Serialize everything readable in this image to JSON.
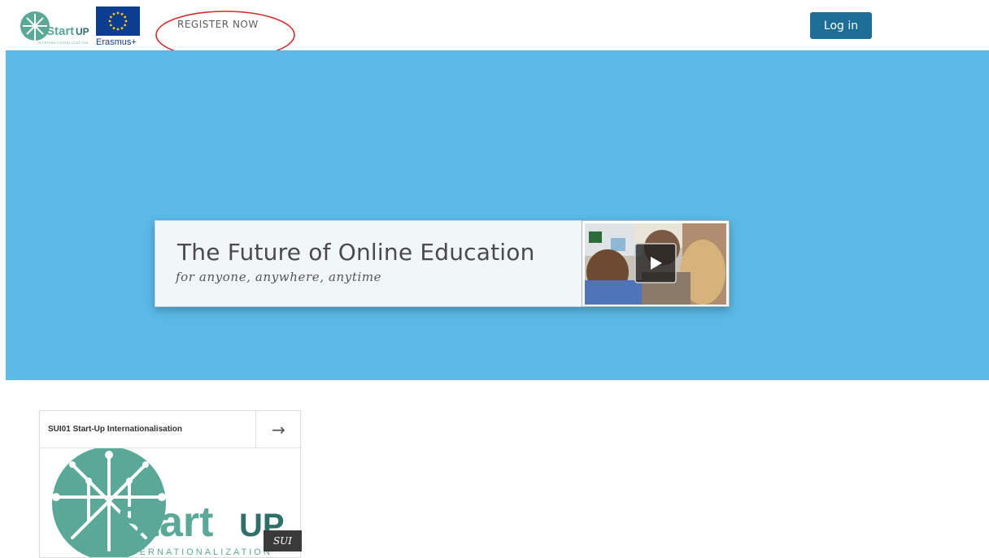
{
  "header": {
    "logo_startup": {
      "icon": "startup-tree-logo",
      "word_start": "Start",
      "word_up": "UP",
      "tagline": "INTERNATIONALIZATION"
    },
    "logo_eu": {
      "icon": "eu-flag-icon",
      "label": "Erasmus+"
    },
    "register_label": "REGISTER NOW",
    "login_label": "Log in"
  },
  "hero": {
    "title": "The Future of Online Education",
    "subtitle": "for anyone, anywhere, anytime",
    "video_icon": "play-icon"
  },
  "course_card": {
    "title": "SUI01 Start-Up Internationalisation",
    "arrow": "→",
    "image": {
      "word_start": "Start",
      "word_up": "UP",
      "tagline": "INTERNATIONALIZATION"
    },
    "tag": "SUI"
  },
  "colors": {
    "brand_teal": "#5aa898",
    "hero_blue": "#5ab9e6",
    "login_button": "#1c6e96",
    "eu_blue": "#0b3d91",
    "eu_star": "#ffcc00",
    "annotation_red": "#d42a2a"
  }
}
